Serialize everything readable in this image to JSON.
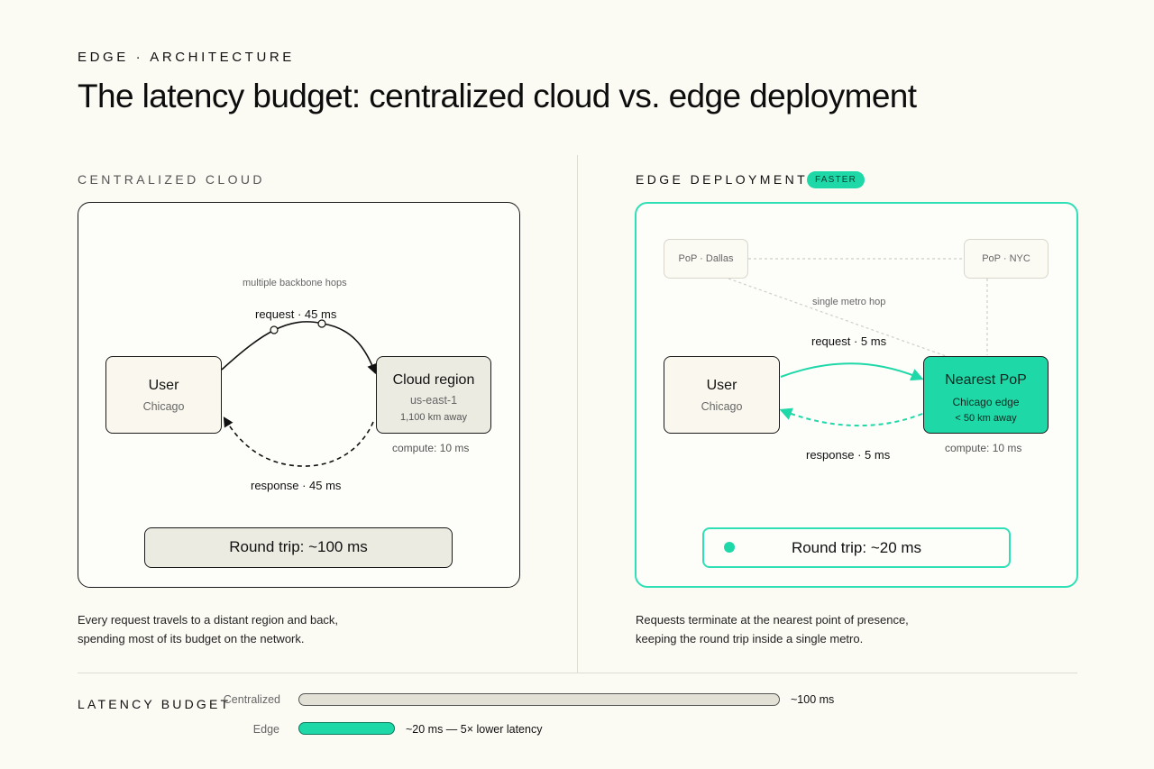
{
  "eyebrow": "EDGE · ARCHITECTURE",
  "title": "The latency budget: centralized cloud vs. edge deployment",
  "colors": {
    "accent": "#1fd8a8",
    "ink": "#111111",
    "paper": "#fbfaf3"
  },
  "centralized": {
    "label": "CENTRALIZED CLOUD",
    "user": {
      "name": "User",
      "location": "Chicago"
    },
    "region": {
      "name": "Cloud region",
      "id": "us-east-1",
      "distance": "1,100 km away"
    },
    "hops_note": "multiple backbone hops",
    "request": "request · 45 ms",
    "response": "response · 45 ms",
    "compute": "compute: 10 ms",
    "round_trip": "Round trip: ~100 ms",
    "caption_line1": "Every request travels to a distant region and back,",
    "caption_line2": "spending most of its budget on the network."
  },
  "edge": {
    "label": "EDGE DEPLOYMENT",
    "badge": "FASTER",
    "pop_dallas": "PoP · Dallas",
    "pop_nyc": "PoP · NYC",
    "metro_note": "single metro hop",
    "user": {
      "name": "User",
      "location": "Chicago"
    },
    "nearest": {
      "name": "Nearest PoP",
      "location": "Chicago edge",
      "distance": "< 50 km away"
    },
    "request": "request · 5 ms",
    "response": "response · 5 ms",
    "compute": "compute: 10 ms",
    "round_trip": "Round trip: ~20 ms",
    "caption_line1": "Requests terminate at the nearest point of presence,",
    "caption_line2": "keeping the round trip inside a single metro."
  },
  "budget": {
    "title": "LATENCY BUDGET",
    "rows": [
      {
        "label": "Centralized",
        "value_ms": 100,
        "value_text": "~100 ms"
      },
      {
        "label": "Edge",
        "value_ms": 20,
        "value_text": "~20 ms — 5× lower latency"
      }
    ]
  }
}
